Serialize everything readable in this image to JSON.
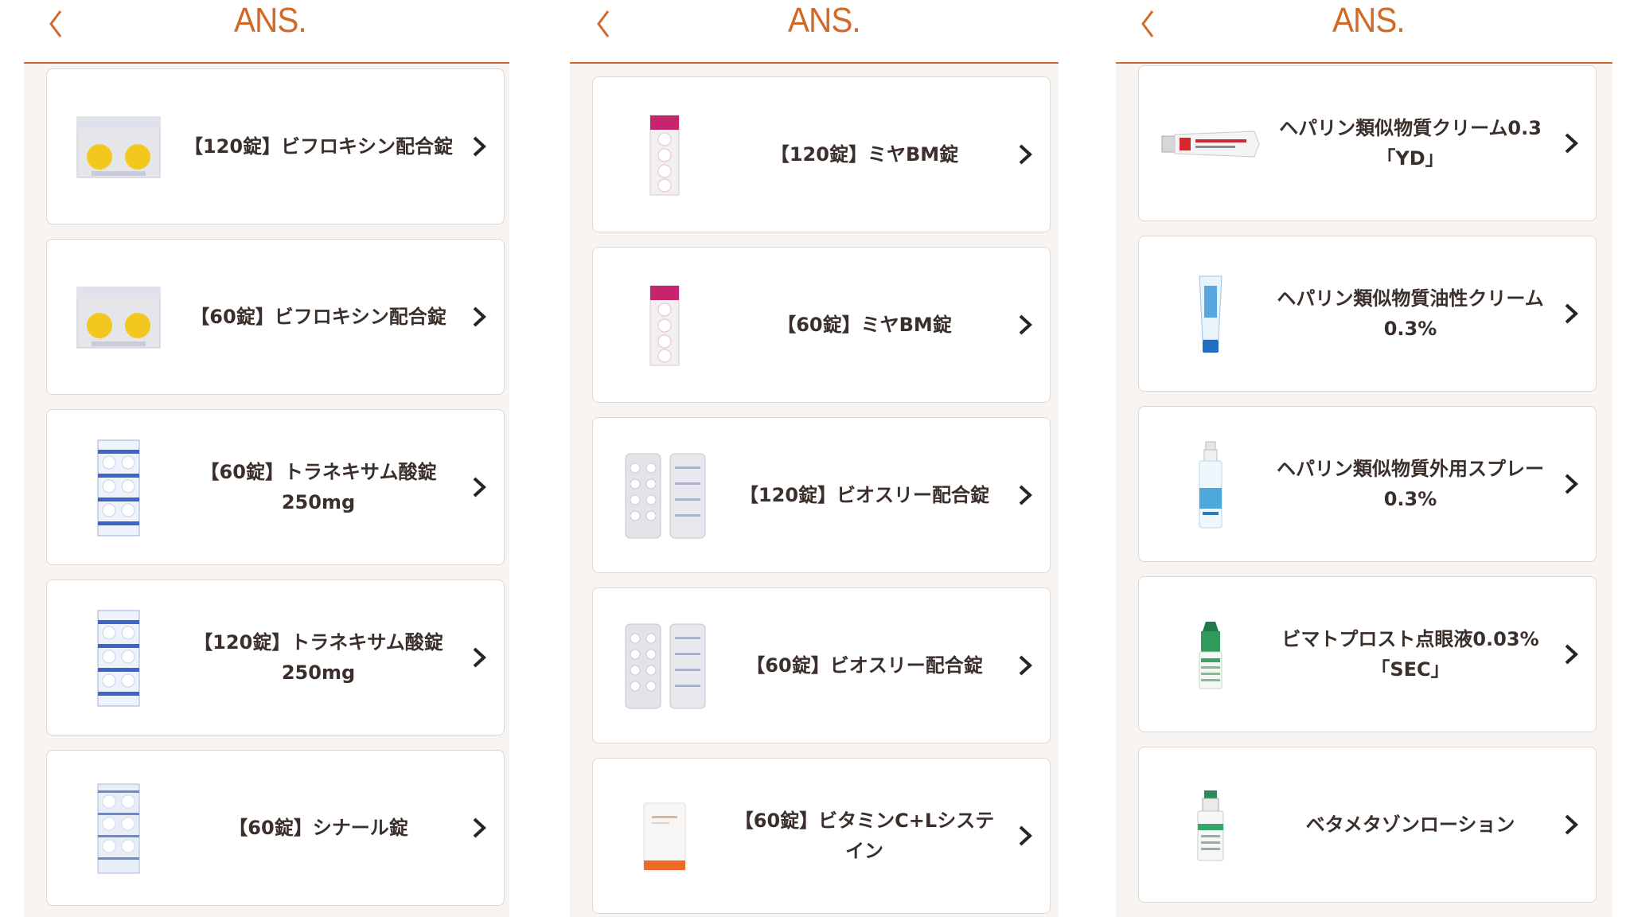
{
  "app": {
    "logo": "ANS.",
    "accent": "#d06a2a"
  },
  "screens": [
    {
      "items": [
        {
          "label": "【120錠】ビフロキシン配合錠",
          "icon": "blister-yellow-2"
        },
        {
          "label": "【60錠】ビフロキシン配合錠",
          "icon": "blister-yellow-2"
        },
        {
          "label": "【60錠】トラネキサム酸錠\n250mg",
          "icon": "blister-blue-tall"
        },
        {
          "label": "【120錠】トラネキサム酸錠\n250mg",
          "icon": "blister-blue-tall"
        },
        {
          "label": "【60錠】シナール錠",
          "icon": "blister-blue-tall"
        }
      ]
    },
    {
      "items": [
        {
          "label": "【120錠】ミヤBM錠",
          "icon": "strip-pink"
        },
        {
          "label": "【60錠】ミヤBM錠",
          "icon": "strip-pink"
        },
        {
          "label": "【120錠】ビオスリー配合錠",
          "icon": "blister-gray-2"
        },
        {
          "label": "【60錠】ビオスリー配合錠",
          "icon": "blister-gray-2"
        },
        {
          "label": "【60錠】ビタミンC+Lシステ\nイン",
          "icon": "pouch-white"
        }
      ]
    },
    {
      "items": [
        {
          "label": "ヘパリン類似物質クリーム0.3\n「YD」",
          "icon": "tube-red"
        },
        {
          "label": "ヘパリン類似物質油性クリーム\n0.3%",
          "icon": "tube-blue"
        },
        {
          "label": "ヘパリン類似物質外用スプレー\n0.3%",
          "icon": "spray-bottle"
        },
        {
          "label": "ビマトプロスト点眼液0.03%\n「SEC」",
          "icon": "eyedrop-green"
        },
        {
          "label": "ベタメタゾンローション",
          "icon": "lotion-bottle"
        }
      ]
    }
  ]
}
